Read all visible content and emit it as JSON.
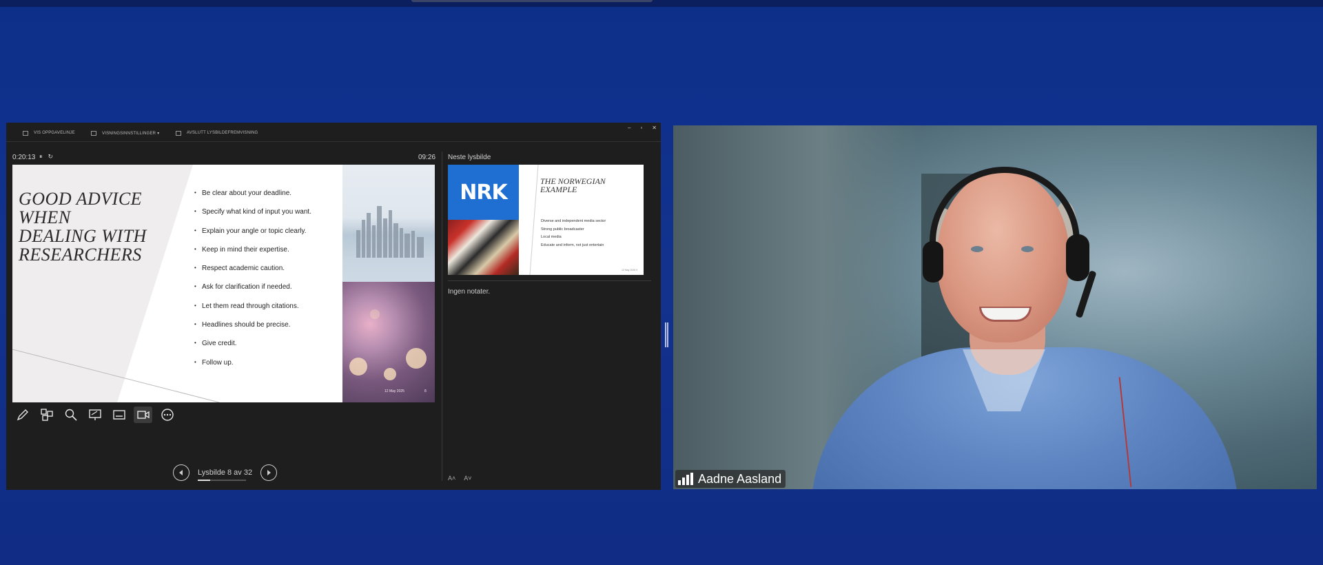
{
  "presenter": {
    "toolbar": {
      "show_taskbar": "VIS OPPGAVELINJE",
      "display_settings": "VISNINGSINNSTILLINGER ▾",
      "end_slideshow": "AVSLUTT LYSBILDEFREMVISNING"
    },
    "window_controls": {
      "minimize": "–",
      "restore": "▫",
      "close": "✕"
    },
    "timer": "0:20:13",
    "clock": "09:26",
    "current_slide": {
      "title": "GOOD ADVICE\nWHEN\nDEALING WITH\nRESEARCHERS",
      "bullets": [
        "Be clear about your deadline.",
        "Specify what kind of input you want.",
        "Explain your angle or topic clearly.",
        "Keep in mind their expertise.",
        "Respect academic caution.",
        "Ask for clarification if needed.",
        "Let them read through citations.",
        "Headlines should be precise.",
        "Give credit.",
        "Follow up."
      ],
      "date": "12 May 2025",
      "number": "8"
    },
    "tools": [
      "pen-icon",
      "slides-grid-icon",
      "zoom-icon",
      "pointer-icon",
      "subtitles-icon",
      "camera-icon",
      "more-icon"
    ],
    "navigation": {
      "counter": "Lysbilde 8 av 32",
      "progress_fraction": 0.25
    },
    "next_slide": {
      "label": "Neste lysbilde",
      "logo": "NRK",
      "title": "THE NORWEGIAN\nEXAMPLE",
      "bullets": [
        "Diverse and independent media sector",
        "Strong public broadcaster",
        "Local media",
        "Educate and inform, not just entertain"
      ],
      "footer": "12 May 2025   9"
    },
    "notes": "Ingen notater.",
    "font_controls": {
      "increase": "A˄",
      "decrease": "A˅"
    }
  },
  "video": {
    "participant_name": "Aadne Aasland",
    "signal_icon": "signal-strength-icon"
  },
  "colors": {
    "background": "#12328e",
    "presenter_bg": "#1e1e1e",
    "nrk_blue": "#1f6fd2"
  }
}
